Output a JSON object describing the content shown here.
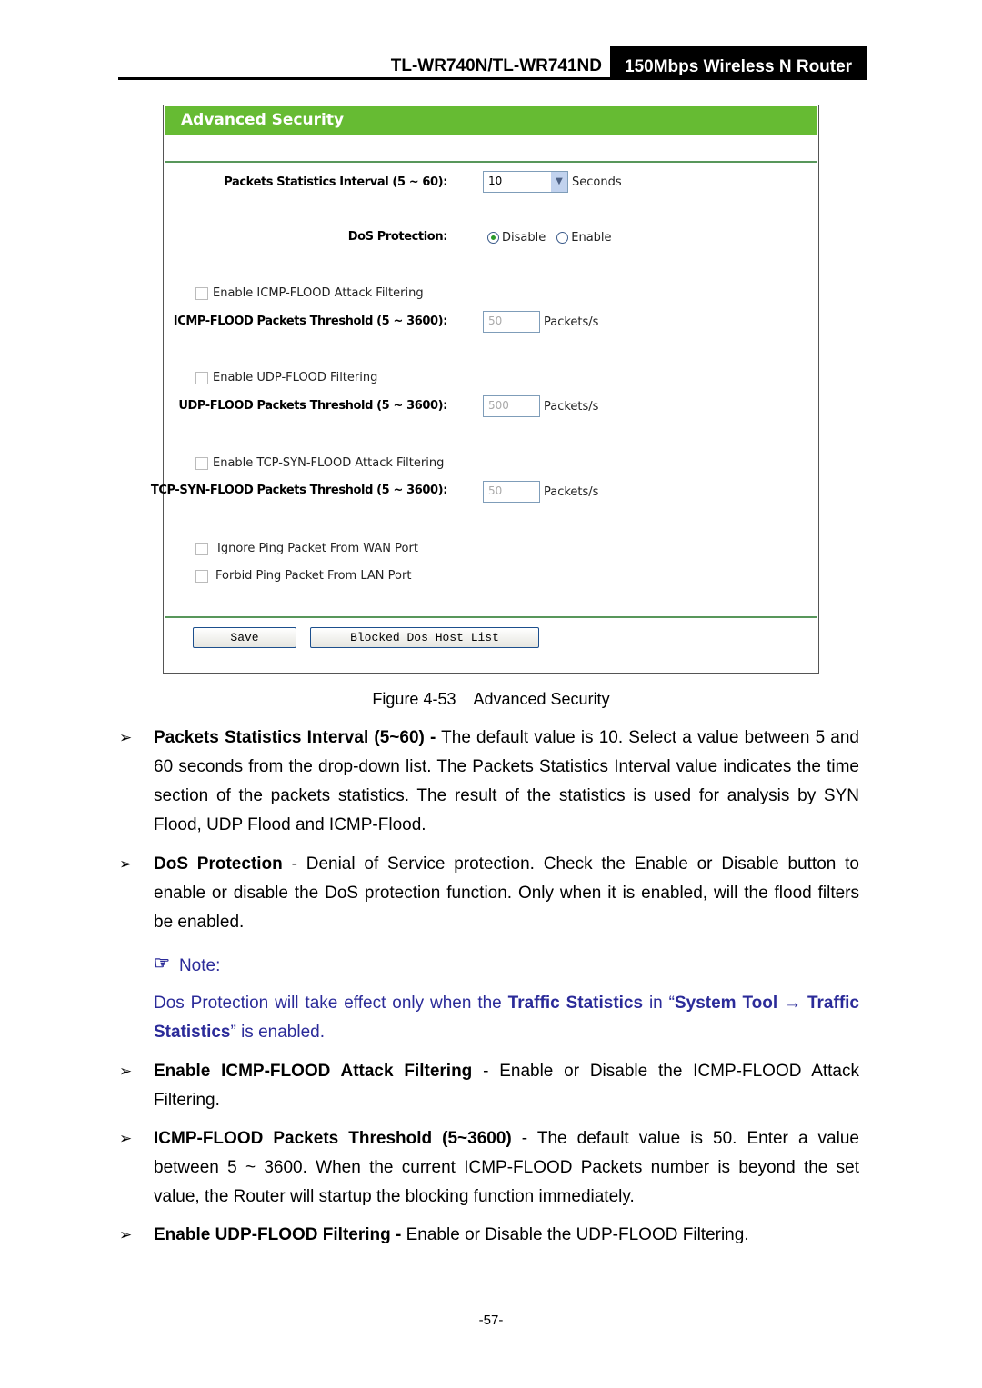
{
  "header": {
    "model": "TL-WR740N/TL-WR741ND",
    "product": "150Mbps Wireless N Router"
  },
  "figure": {
    "title": "Advanced Security",
    "interval_label": "Packets Statistics Interval (5 ~ 60):",
    "interval_value": "10",
    "interval_unit": "Seconds",
    "dos_label": "DoS Protection:",
    "dos_disable": "Disable",
    "dos_enable": "Enable",
    "dos_selected": "Disable",
    "icmp_enable": "Enable ICMP-FLOOD Attack Filtering",
    "icmp_label": "ICMP-FLOOD Packets Threshold (5 ~ 3600):",
    "icmp_value": "50",
    "udp_enable": "Enable UDP-FLOOD Filtering",
    "udp_label": "UDP-FLOOD Packets Threshold (5 ~ 3600):",
    "udp_value": "500",
    "tcp_enable": "Enable TCP-SYN-FLOOD Attack Filtering",
    "tcp_label": "TCP-SYN-FLOOD Packets Threshold (5 ~ 3600):",
    "tcp_value": "50",
    "unit_packets": "Packets/s",
    "ignore_ping": "Ignore Ping Packet From WAN Port",
    "forbid_ping": "Forbid Ping Packet From LAN Port",
    "save": "Save",
    "blocked": "Blocked Dos Host List",
    "accent": "#66bb33"
  },
  "caption": "Figure 4-53    Advanced Security",
  "bullets": [
    {
      "term": "Packets Statistics Interval (5~60) -",
      "text": " The default value is 10. Select a value between 5 and 60 seconds from the drop-down list. The Packets Statistics Interval value indicates the time section of the packets statistics. The result of the statistics is used for analysis by SYN Flood, UDP Flood and ICMP-Flood."
    },
    {
      "term": "DoS Protection",
      "text": " - Denial of Service protection. Check the Enable or Disable button to enable or disable the DoS protection function. Only when it is enabled, will the flood filters be enabled."
    },
    {
      "term": "Enable ICMP-FLOOD Attack Filtering",
      "text": " - Enable or Disable the ICMP-FLOOD Attack Filtering."
    },
    {
      "term": "ICMP-FLOOD Packets Threshold (5~3600)",
      "text": " - The default value is 50. Enter a value between 5 ~ 3600. When the current ICMP-FLOOD Packets number is beyond the set value, the Router will startup the blocking function immediately."
    },
    {
      "term": "Enable UDP-FLOOD Filtering -",
      "text": " Enable or Disable the UDP-FLOOD Filtering."
    }
  ],
  "note": {
    "title": "Note:",
    "t1": "Dos Protection will take effect only when the ",
    "b1": "Traffic Statistics",
    "t2": " in “",
    "b2": "System Tool",
    "arrow": " → ",
    "b3": "Traffic Statistics",
    "t3": "” is enabled.",
    "color": "#2b2b99"
  },
  "page_number": "-57-"
}
